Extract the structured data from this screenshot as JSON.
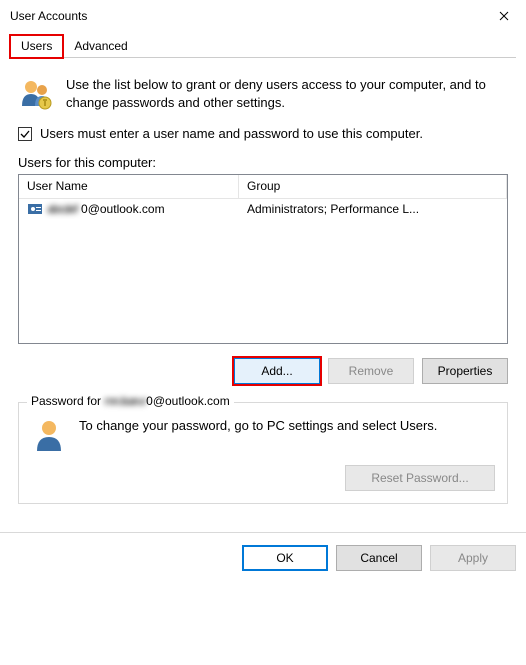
{
  "window": {
    "title": "User Accounts"
  },
  "tabs": {
    "users": "Users",
    "advanced": "Advanced",
    "active": "users"
  },
  "description": "Use the list below to grant or deny users access to your computer, and to change passwords and other settings.",
  "checkbox": {
    "label": "Users must enter a user name and password to use this computer.",
    "checked": true
  },
  "list": {
    "label": "Users for this computer:",
    "columns": {
      "user": "User Name",
      "group": "Group"
    },
    "rows": [
      {
        "user_prefix_blur": "abcdef",
        "user_suffix": "0@outlook.com",
        "group": "Administrators; Performance L..."
      }
    ]
  },
  "buttons": {
    "add": "Add...",
    "remove": "Remove",
    "properties": "Properties"
  },
  "password_group": {
    "title_prefix": "Password for ",
    "title_blur": "mn.lsarv.r",
    "title_suffix": "0@outlook.com",
    "text": "To change your password, go to PC settings and select Users.",
    "reset": "Reset Password..."
  },
  "footer": {
    "ok": "OK",
    "cancel": "Cancel",
    "apply": "Apply"
  }
}
